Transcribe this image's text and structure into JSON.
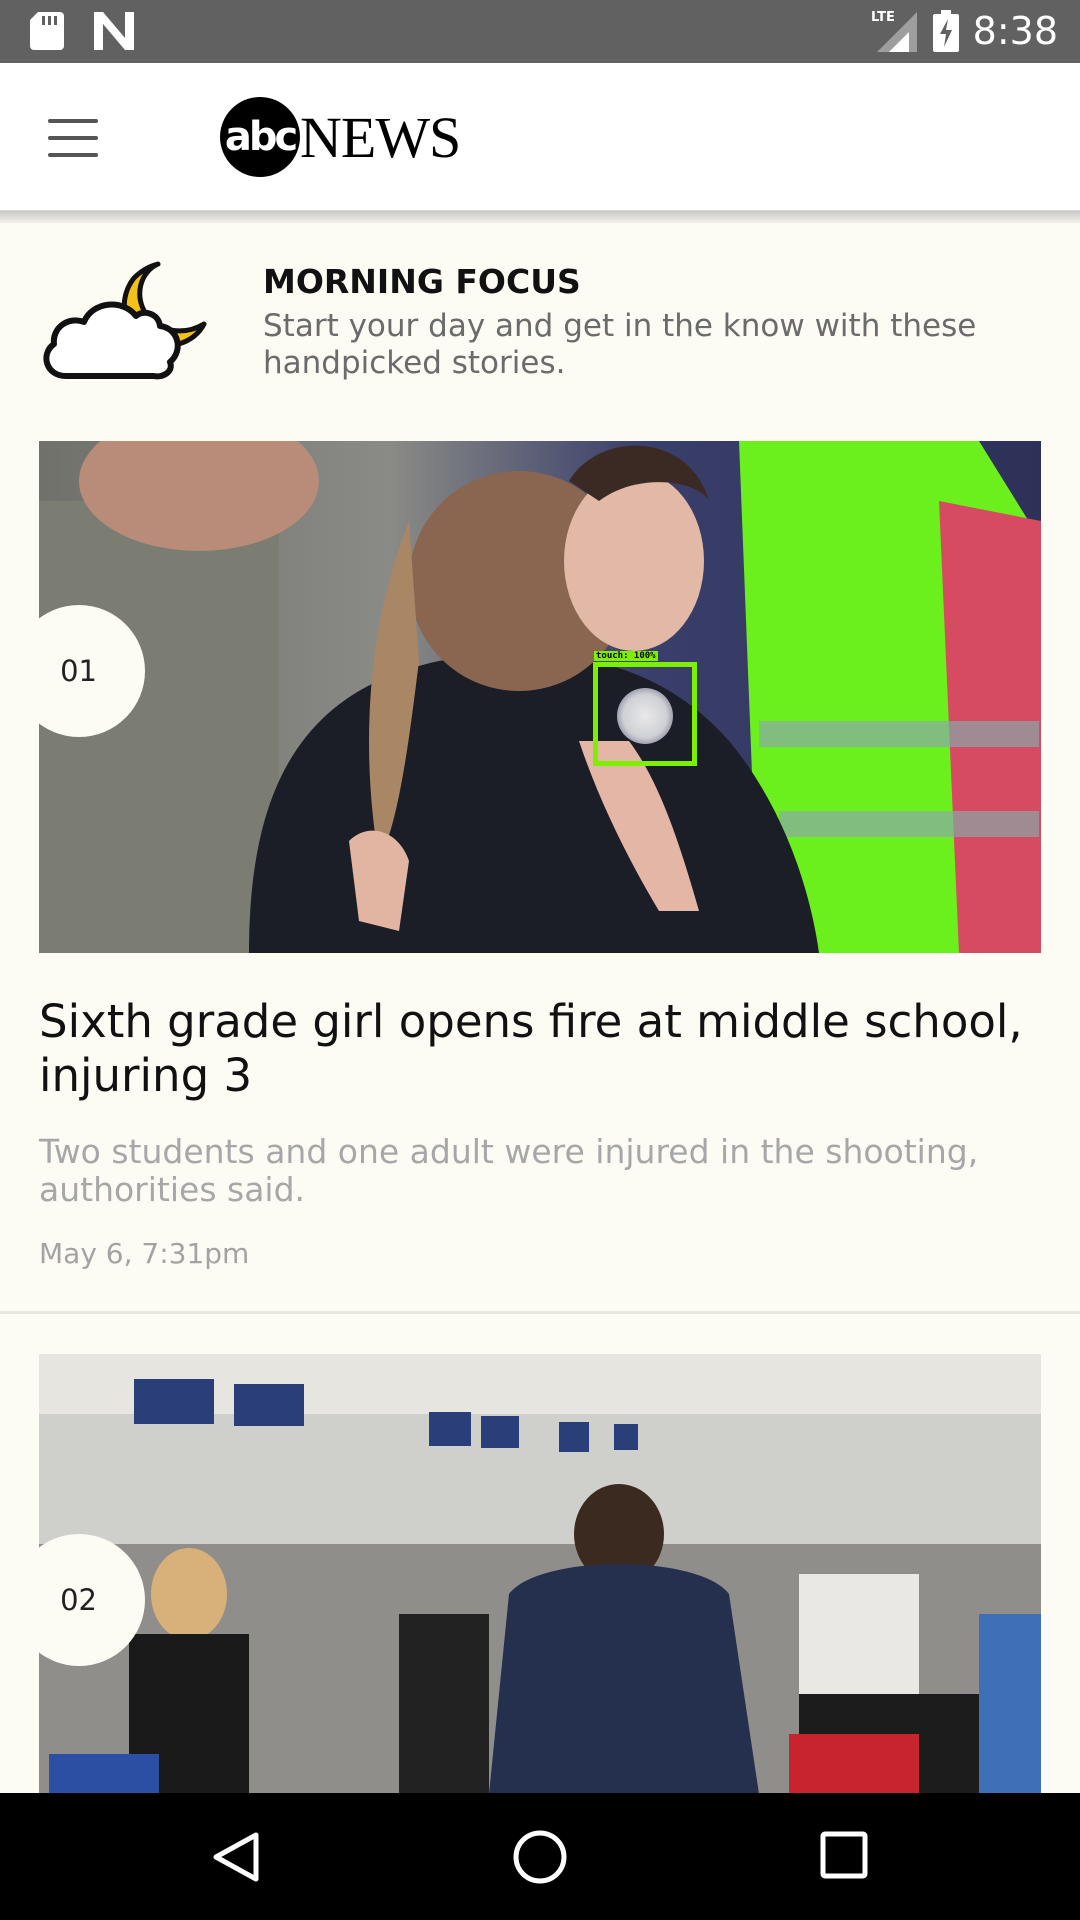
{
  "status_bar": {
    "time": "8:38",
    "network": "LTE",
    "icons": [
      "sd-card-icon",
      "n-icon",
      "lte-signal-icon",
      "battery-charging-icon"
    ]
  },
  "app_bar": {
    "menu_icon": "hamburger-menu-icon",
    "logo_abc": "abc",
    "logo_news": "NEWS"
  },
  "focus": {
    "icon": "moon-cloud-icon",
    "title": "MORNING FOCUS",
    "subtitle": "Start your day and get in the know with these handpicked stories."
  },
  "stories": [
    {
      "number": "01",
      "title": "Sixth grade girl opens fire at middle school, injuring 3",
      "description": "Two students and one adult were injured in the shooting, authorities said.",
      "date": "May 6, 7:31pm"
    },
    {
      "number": "02"
    }
  ],
  "touch_marker": {
    "label": "touch: 100%",
    "color": "#7cf000"
  },
  "nav_bar": {
    "buttons": [
      "back-icon",
      "home-icon",
      "recents-icon"
    ]
  }
}
